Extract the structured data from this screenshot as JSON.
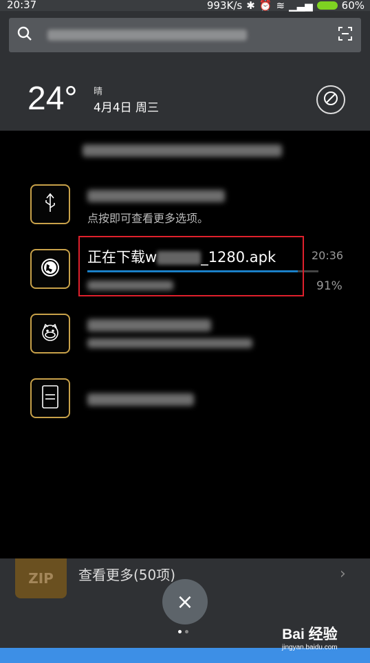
{
  "status_bar": {
    "time": "20:37",
    "speed": "993K/s",
    "battery": "60%"
  },
  "weather": {
    "temp": "24°",
    "condition": "晴",
    "date": "4月4日 周三"
  },
  "notifications": {
    "hint_text": "点按即可查看更多选项。",
    "download": {
      "title_prefix": "正在下载w",
      "title_suffix": "_1280.apk",
      "time": "20:36",
      "percent": "91%",
      "progress": 0.91
    }
  },
  "file_list": {
    "zip_label": "ZIP",
    "more_label": "查看更多(50项)"
  },
  "close_label": "×",
  "watermark": {
    "logo": "Bai 经验",
    "sub": "jingyan.baidu.com"
  },
  "colors": {
    "accent": "#1b80c8",
    "icon_border": "#c9a24a",
    "highlight": "#e0202c",
    "nav": "#3d8fe6"
  }
}
